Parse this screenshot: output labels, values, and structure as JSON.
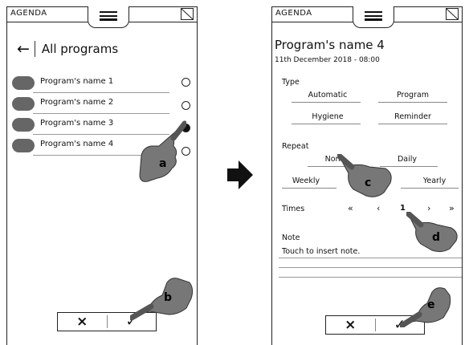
{
  "app_title": "AGENDA",
  "left": {
    "title": "All programs",
    "programs": [
      {
        "name": "Program's name 1",
        "selected": false
      },
      {
        "name": "Program's name 2",
        "selected": false
      },
      {
        "name": "Program's name 3",
        "selected": true
      },
      {
        "name": "Program's name 4",
        "selected": false
      }
    ],
    "cancel": "×",
    "confirm": "✓"
  },
  "right": {
    "title": "Program's name 4",
    "date": "11th December 2018 - 08:00",
    "type_label": "Type",
    "types": [
      "Automatic",
      "Program",
      "Hygiene",
      "Reminder"
    ],
    "repeat_label": "Repeat",
    "repeats": [
      "None",
      "Daily",
      "Weekly",
      "Yearly"
    ],
    "times_label": "Times",
    "pager": {
      "first": "«",
      "prev": "‹",
      "value": "1",
      "next": "›",
      "last": "»"
    },
    "note_label": "Note",
    "note_placeholder": "Touch to insert note.",
    "cancel": "×",
    "confirm": "✓"
  },
  "callouts": [
    "a",
    "b",
    "c",
    "d",
    "e"
  ],
  "icons": {
    "menu": "hamburger-icon",
    "corner": "page-corner-icon",
    "back": "back-arrow-icon",
    "transition": "right-arrow-icon",
    "gesture": "pointing-hand-icon"
  }
}
